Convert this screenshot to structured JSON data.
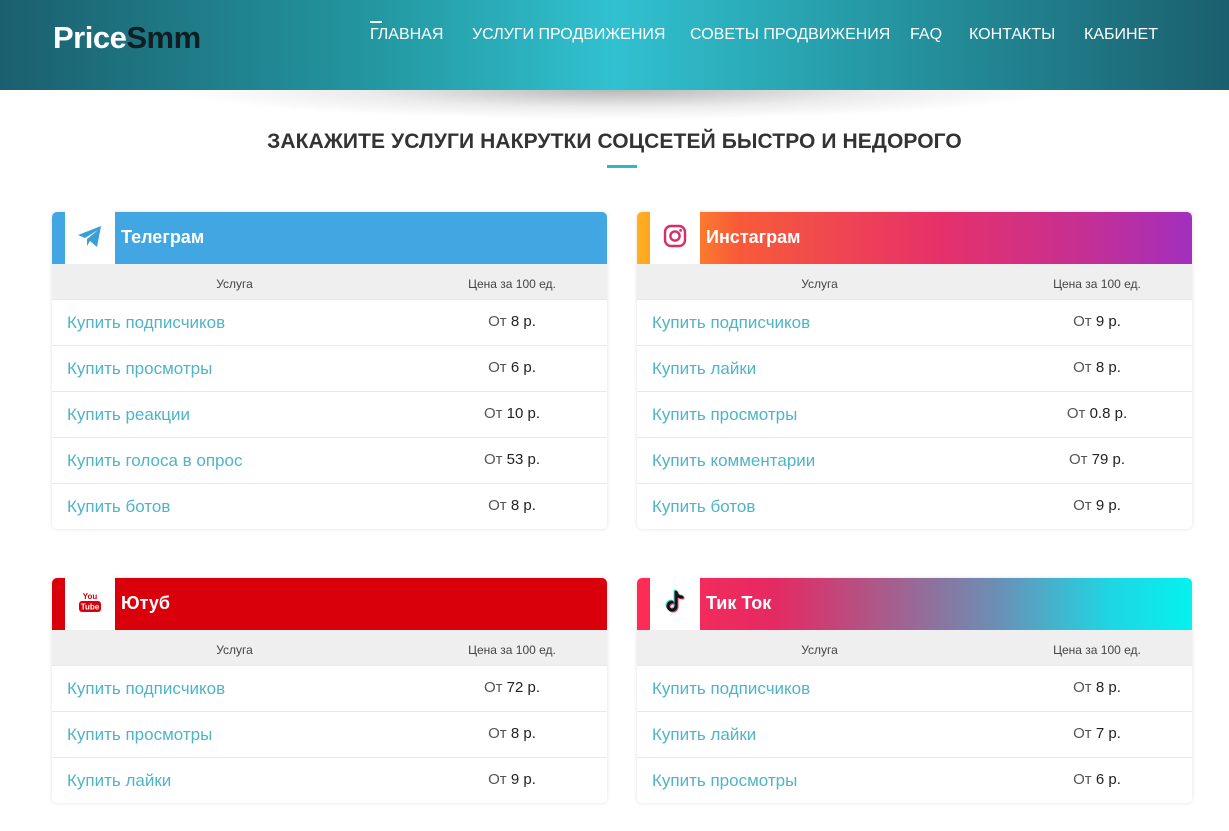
{
  "header": {
    "logo_part1": "Price",
    "logo_part2": "Smm",
    "nav": [
      "Главная",
      "Услуги продвижения",
      "Советы продвижения",
      "FAQ",
      "Контакты",
      "Кабинет"
    ]
  },
  "page_title": "ЗАКАЖИТЕ УСЛУГИ НАКРУТКИ СОЦСЕТЕЙ БЫСТРО И НЕДОРОГО",
  "table_headers": {
    "service": "Услуга",
    "price": "Цена за 100 ед."
  },
  "price_prefix": "От",
  "cards": [
    {
      "title": "Телеграм",
      "icon": "telegram-icon",
      "color": "#41a6e1",
      "rows": [
        {
          "service": "Купить подписчиков",
          "price": "8 р."
        },
        {
          "service": "Купить просмотры",
          "price": "6 р."
        },
        {
          "service": "Купить реакции",
          "price": "10 р."
        },
        {
          "service": "Купить голоса в опрос",
          "price": "53 р."
        },
        {
          "service": "Купить ботов",
          "price": "8 р."
        }
      ]
    },
    {
      "title": "Инстаграм",
      "icon": "instagram-icon",
      "color": "#e1306c",
      "rows": [
        {
          "service": "Купить подписчиков",
          "price": "9 р."
        },
        {
          "service": "Купить лайки",
          "price": "8 р."
        },
        {
          "service": "Купить просмотры",
          "price": "0.8 р."
        },
        {
          "service": "Купить комментарии",
          "price": "79 р."
        },
        {
          "service": "Купить ботов",
          "price": "9 р."
        }
      ]
    },
    {
      "title": "Ютуб",
      "icon": "youtube-icon",
      "color": "#d9000b",
      "rows": [
        {
          "service": "Купить подписчиков",
          "price": "72 р."
        },
        {
          "service": "Купить просмотры",
          "price": "8 р."
        },
        {
          "service": "Купить лайки",
          "price": "9 р."
        }
      ]
    },
    {
      "title": "Тик Ток",
      "icon": "tiktok-icon",
      "color": "#fe2c55",
      "rows": [
        {
          "service": "Купить подписчиков",
          "price": "8 р."
        },
        {
          "service": "Купить лайки",
          "price": "7 р."
        },
        {
          "service": "Купить просмотры",
          "price": "6 р."
        }
      ]
    }
  ]
}
